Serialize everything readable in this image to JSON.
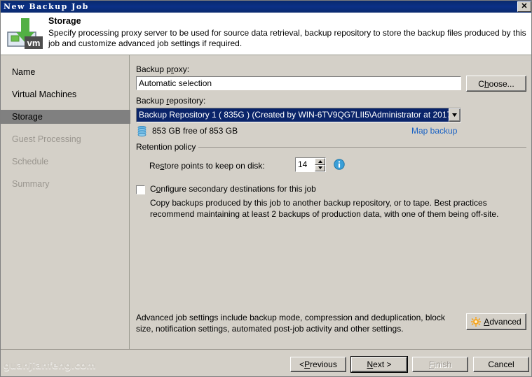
{
  "window": {
    "title": "New Backup Job",
    "close_label": "✕"
  },
  "header": {
    "title": "Storage",
    "description": "Specify processing proxy server to be used for source data retrieval, backup repository to store the backup files produced by this job and customize advanced job settings if required.",
    "icon": "vm-backup-icon",
    "icon_badge": "vm"
  },
  "sidebar": {
    "items": [
      {
        "label": "Name",
        "state": "enabled"
      },
      {
        "label": "Virtual Machines",
        "state": "enabled"
      },
      {
        "label": "Storage",
        "state": "active"
      },
      {
        "label": "Guest Processing",
        "state": "disabled"
      },
      {
        "label": "Schedule",
        "state": "disabled"
      },
      {
        "label": "Summary",
        "state": "disabled"
      }
    ]
  },
  "main": {
    "backup_proxy": {
      "label_pre": "Backup p",
      "label_accel": "r",
      "label_post": "oxy:",
      "value": "Automatic selection",
      "choose_pre": "C",
      "choose_accel": "h",
      "choose_post": "oose..."
    },
    "backup_repository": {
      "label_pre": "Backup ",
      "label_accel": "r",
      "label_post": "epository:",
      "value": "Backup Repository 1 ( 835G )  (Created by WIN-6TV9QG7LII5\\Administrator at 2017/",
      "dropdown_arrow": "▼",
      "free_space": "853 GB free of 853 GB",
      "map_backup_link": "Map backup",
      "disk_icon": "disk-stack-icon"
    },
    "retention": {
      "group_label": "Retention policy",
      "restore_label_pre": "Re",
      "restore_label_accel": "s",
      "restore_label_post": "tore points to keep on disk:",
      "restore_points": "14",
      "spin_up": "▲",
      "spin_down": "▼",
      "info_icon": "info-icon"
    },
    "secondary": {
      "checkbox_checked": false,
      "label_pre": "C",
      "label_accel": "o",
      "label_post": "nfigure secondary destinations for this job",
      "description": "Copy backups produced by this job to another backup repository, or to tape. Best practices recommend maintaining at least 2 backups of production data, with one of them being off-site."
    },
    "advanced": {
      "description": "Advanced job settings include backup mode, compression and deduplication, block size, notification settings, automated post-job activity and other settings.",
      "button_pre": "",
      "button_accel": "A",
      "button_post": "dvanced",
      "icon": "gear-icon"
    }
  },
  "footer": {
    "buttons": [
      {
        "pre": "< ",
        "accel": "P",
        "post": "revious",
        "state": "enabled",
        "name": "previous-button"
      },
      {
        "pre": "",
        "accel": "N",
        "post": "ext >",
        "state": "default",
        "name": "next-button"
      },
      {
        "pre": "",
        "accel": "F",
        "post": "inish",
        "state": "disabled",
        "name": "finish-button"
      },
      {
        "pre": "Cancel",
        "accel": "",
        "post": "",
        "state": "enabled",
        "name": "cancel-button"
      }
    ]
  },
  "watermark": "guanjianfeng.com",
  "colors": {
    "titlebar": "#0b3087",
    "dialog_face": "#d4d0c8",
    "selection": "#0a246a",
    "link": "#1a62c4",
    "active_nav": "#808080",
    "disabled_text": "#9a968f",
    "accent_green": "#52b043",
    "accent_orange": "#f5a623",
    "disk_blue": "#3a9fd8"
  }
}
